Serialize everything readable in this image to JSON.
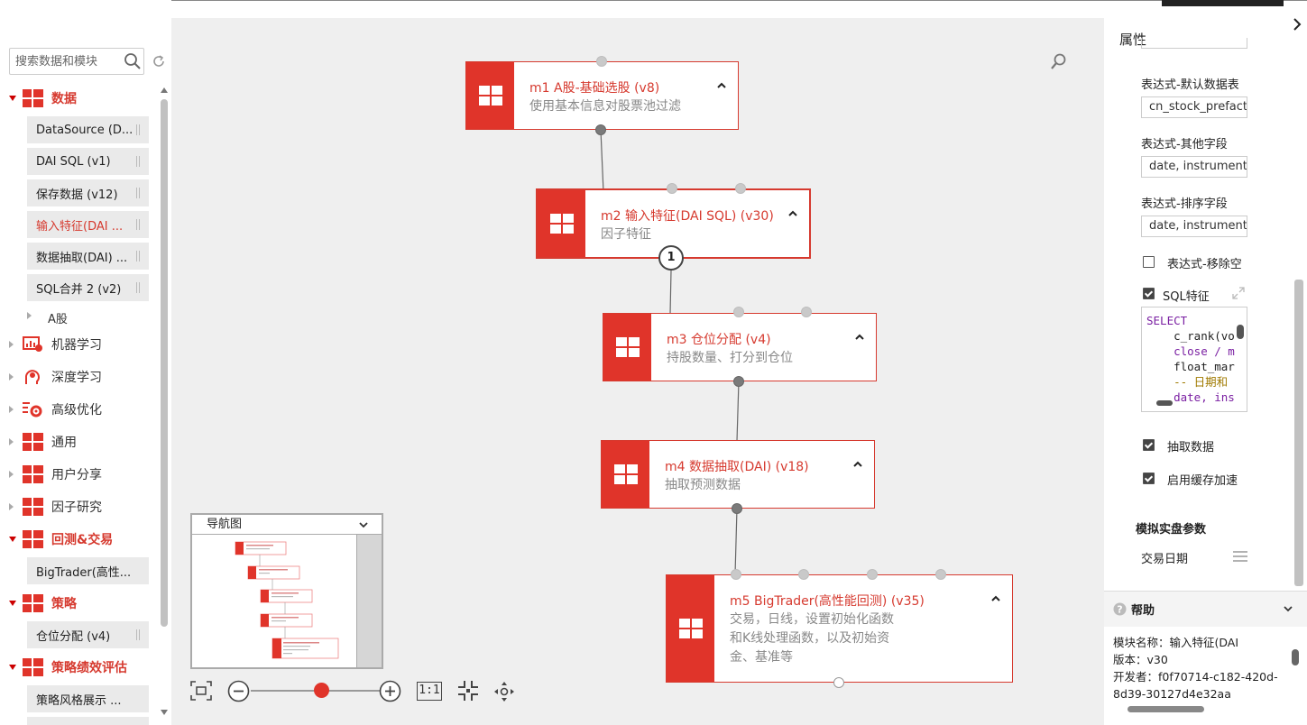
{
  "sidebar": {
    "search_placeholder": "搜索数据和模块",
    "categories": {
      "data": "数据",
      "ml": "机器学习",
      "dl": "深度学习",
      "opt": "高级优化",
      "common": "通用",
      "share": "用户分享",
      "factor": "因子研究",
      "backtest": "回测&交易",
      "strategy": "策略",
      "perf": "策略绩效评估"
    },
    "items": {
      "datasource": "DataSource (D...",
      "daisql": "DAI SQL (v1)",
      "save": "保存数据 (v12)",
      "input_feature": "输入特征(DAI ...",
      "extract": "数据抽取(DAI) ...",
      "sqlmerge": "SQL合并 2 (v2)",
      "ashare": "A股",
      "bigtrader": "BigTrader(高性...",
      "position": "仓位分配 (v4)",
      "style": "策略风格展示 ..."
    }
  },
  "nodes": [
    {
      "title": "m1 A股-基础选股 (v8)",
      "desc": "使用基本信息对股票池过滤"
    },
    {
      "title": "m2 输入特征(DAI SQL) (v30)",
      "desc": "因子特征"
    },
    {
      "title": "m3 仓位分配 (v4)",
      "desc": "持股数量、打分到仓位"
    },
    {
      "title": "m4 数据抽取(DAI) (v18)",
      "desc": "抽取预测数据"
    },
    {
      "title": "m5 BigTrader(高性能回测) (v35)",
      "desc_lines": [
        "交易，日线，设置初始化函数",
        "和K线处理函数，以及初始资",
        "金、基准等"
      ]
    }
  ],
  "badge": "1",
  "navigator": {
    "title": "导航图"
  },
  "toolbar": {
    "one_to_one": "1:1",
    "zoom_level": 0.65
  },
  "props": {
    "title": "属性",
    "f1_label": "表达式-默认数据表",
    "f1_value": "cn_stock_prefact",
    "f2_label": "表达式-其他字段",
    "f2_value": "date, instrument",
    "f3_label": "表达式-排序字段",
    "f3_value": "date, instrument",
    "cb_remove": "表达式-移除空",
    "cb_sql": "SQL特征",
    "code": [
      "SELECT",
      "    c_rank(vo",
      "    close / m",
      "    float_mar",
      "    -- 日期和",
      "    date, ins"
    ],
    "cb_extract": "抽取数据",
    "cb_cache": "启用缓存加速",
    "section_sim": "模拟实盘参数",
    "trade_date": "交易日期"
  },
  "help": {
    "title": "帮助",
    "line1": "模块名称：输入特征(DAI",
    "line2": "版本：v30",
    "line3": "开发者：f0f70714-c182-420d-",
    "line4": "8d39-30127d4e32aa"
  },
  "colors": {
    "accent": "#e0342a",
    "text_red": "#d63a2f",
    "canvas": "#efefef"
  }
}
